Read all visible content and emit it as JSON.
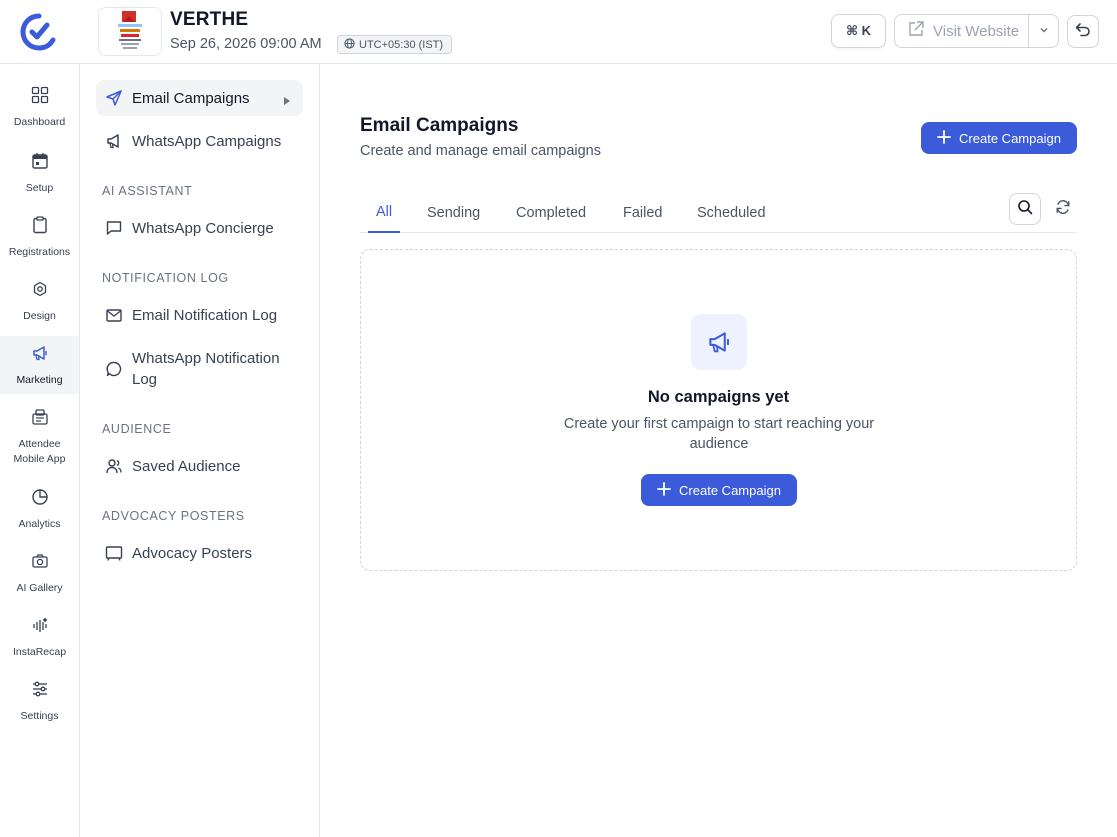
{
  "header": {
    "event_name": "VERTHE",
    "event_date": "Sep 26, 2026 09:00 AM",
    "timezone": "UTC+05:30 (IST)",
    "shortcut_label": "⌘ K",
    "visit_website_label": "Visit Website"
  },
  "rail": {
    "items": [
      {
        "label": "Dashboard",
        "icon": "grid-icon"
      },
      {
        "label": "Setup",
        "icon": "calendar-icon"
      },
      {
        "label": "Registrations",
        "icon": "clipboard-icon"
      },
      {
        "label": "Design",
        "icon": "settings-hex-icon"
      },
      {
        "label": "Marketing",
        "icon": "megaphone-icon",
        "active": true
      },
      {
        "label": "Attendee Mobile App",
        "icon": "app-icon"
      },
      {
        "label": "Analytics",
        "icon": "pie-chart-icon"
      },
      {
        "label": "AI Gallery",
        "icon": "camera-icon"
      },
      {
        "label": "InstaRecap",
        "icon": "sound-wave-icon"
      },
      {
        "label": "Settings",
        "icon": "sliders-icon"
      }
    ]
  },
  "subnav": {
    "email_campaigns": "Email Campaigns",
    "whatsapp_campaigns": "WhatsApp Campaigns",
    "section_ai": "AI ASSISTANT",
    "whatsapp_concierge": "WhatsApp Concierge",
    "section_notification": "NOTIFICATION LOG",
    "email_notification_log": "Email Notification Log",
    "whatsapp_notification_log": "WhatsApp Notification Log",
    "section_audience": "AUDIENCE",
    "saved_audience": "Saved Audience",
    "section_advocacy": "ADVOCACY POSTERS",
    "advocacy_posters": "Advocacy Posters"
  },
  "main": {
    "title": "Email Campaigns",
    "subtitle": "Create and manage email campaigns",
    "create_button": "Create Campaign",
    "tabs": [
      "All",
      "Sending",
      "Completed",
      "Failed",
      "Scheduled"
    ],
    "active_tab": "All",
    "empty": {
      "title": "No campaigns yet",
      "description": "Create your first campaign to start reaching your audience",
      "button": "Create Campaign"
    }
  },
  "colors": {
    "accent": "#3b5bdb",
    "active_bg": "#f3f4f6",
    "empty_icon_bg": "#eef2ff"
  }
}
